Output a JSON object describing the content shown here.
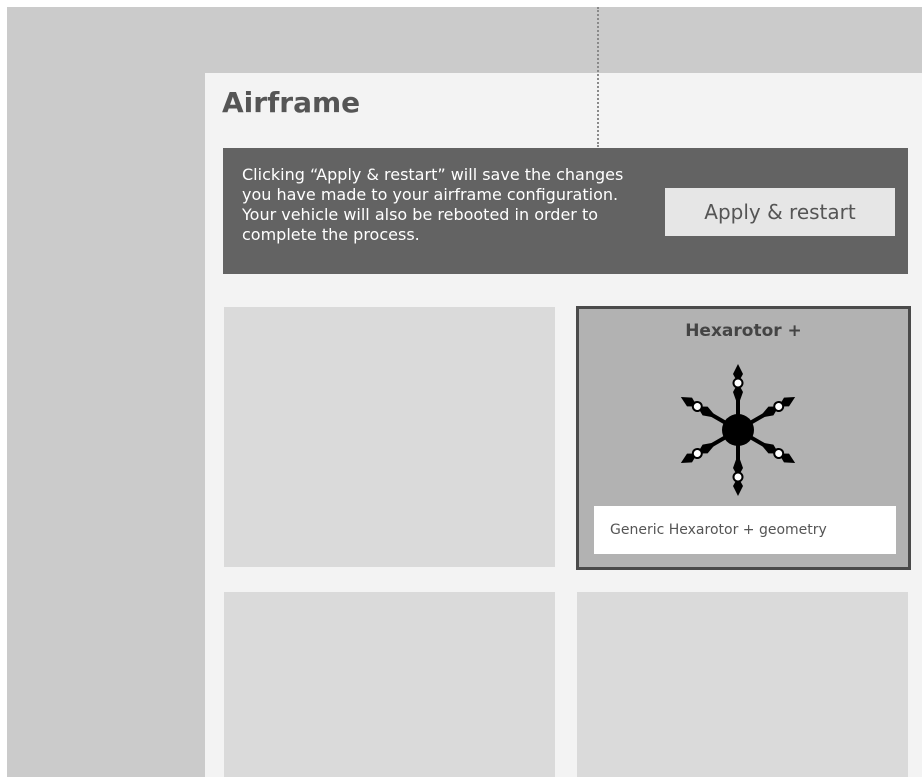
{
  "page": {
    "title": "Airframe"
  },
  "banner": {
    "message": "Clicking “Apply & restart” will save the changes you have made to your airframe configuration. Your vehicle will also be rebooted in order to complete the process.",
    "apply_label": "Apply & restart"
  },
  "airframes": {
    "selected": {
      "name": "Hexarotor +",
      "icon": "hexarotor-plus-icon",
      "description": "Generic Hexarotor + geometry"
    }
  },
  "colors": {
    "banner_bg": "#636363",
    "selected_border": "#4a4a4a",
    "selected_bg": "#b2b2b2"
  }
}
